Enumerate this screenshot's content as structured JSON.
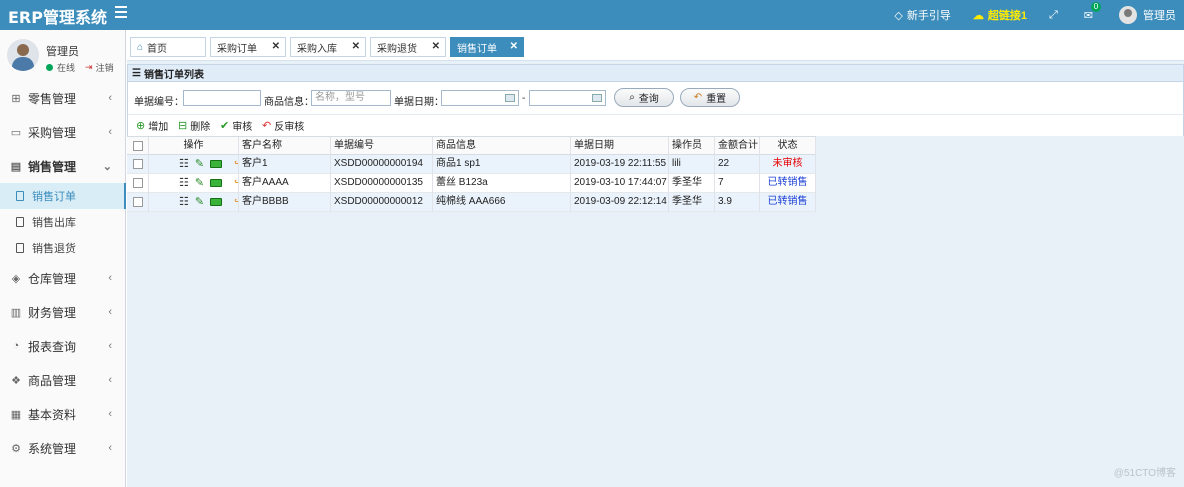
{
  "header": {
    "brand": "ERP管理系统",
    "guide": "新手引导",
    "super_link": "超链接1",
    "mail_count": "0",
    "admin": "管理员"
  },
  "user": {
    "name": "管理员",
    "status": "在线",
    "logout": "注销"
  },
  "sidebar": {
    "items": [
      {
        "label": "零售管理",
        "icon": "gift-icon",
        "arrow": "‹"
      },
      {
        "label": "采购管理",
        "icon": "monitor-icon",
        "arrow": "‹"
      },
      {
        "label": "销售管理",
        "icon": "document-icon",
        "arrow": "⌄"
      },
      {
        "label": "仓库管理",
        "icon": "layers-icon",
        "arrow": "‹"
      },
      {
        "label": "财务管理",
        "icon": "book-icon",
        "arrow": "‹"
      },
      {
        "label": "报表查询",
        "icon": "chart-icon",
        "arrow": "‹"
      },
      {
        "label": "商品管理",
        "icon": "cubes-icon",
        "arrow": "‹"
      },
      {
        "label": "基本资料",
        "icon": "grid-icon",
        "arrow": "‹"
      },
      {
        "label": "系统管理",
        "icon": "gear-icon",
        "arrow": "‹"
      }
    ],
    "sub_items": [
      {
        "label": "销售订单"
      },
      {
        "label": "销售出库"
      },
      {
        "label": "销售退货"
      }
    ]
  },
  "tabs": [
    {
      "label": "首页"
    },
    {
      "label": "采购订单"
    },
    {
      "label": "采购入库"
    },
    {
      "label": "采购退货"
    },
    {
      "label": "销售订单"
    }
  ],
  "panel": {
    "title": "销售订单列表"
  },
  "search": {
    "number_label": "单据编号：",
    "goods_label": "商品信息：",
    "goods_placeholder": "名称，型号",
    "date_label": "单据日期：",
    "dash": "-",
    "query": "查询",
    "reset": "重置"
  },
  "toolbar": {
    "add": "增加",
    "delete": "删除",
    "audit": "审核",
    "unaudit": "反审核"
  },
  "table": {
    "columns": [
      "操作",
      "客户名称",
      "单据编号",
      "商品信息",
      "单据日期",
      "操作员",
      "金额合计",
      "状态"
    ],
    "rows": [
      {
        "customer": "客户1",
        "number": "XSDD00000000194",
        "goods": "商品1 sp1",
        "date": "2019-03-19 22:11:55",
        "operator": "lili",
        "amount": "22",
        "status": "未审核"
      },
      {
        "customer": "客户AAAA",
        "number": "XSDD00000000135",
        "goods": "蕾丝 B123a",
        "date": "2019-03-10 17:44:07",
        "operator": "季圣华",
        "amount": "7",
        "status": "已转销售"
      },
      {
        "customer": "客户BBBB",
        "number": "XSDD00000000012",
        "goods": "纯棉线 AAA666",
        "date": "2019-03-09 22:12:14",
        "operator": "季圣华",
        "amount": "3.9",
        "status": "已转销售"
      }
    ]
  },
  "watermark": "@51CTO博客",
  "colors": {
    "header": "#3c8dbc",
    "status_unaudited": "#e60000",
    "status_converted": "#1a3fd6"
  }
}
